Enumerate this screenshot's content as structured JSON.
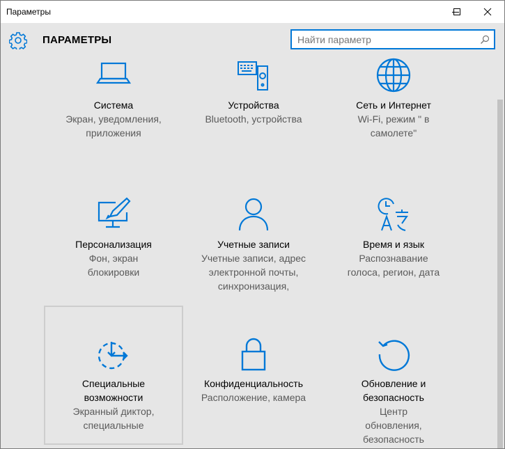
{
  "window": {
    "title": "Параметры",
    "app_title": "ПАРАМЕТРЫ",
    "accent_color": "#0078d7"
  },
  "search": {
    "placeholder": "Найти параметр",
    "icon": "search-icon"
  },
  "tiles": [
    {
      "icon": "laptop-icon",
      "title": "Система",
      "subtitle": "Экран, уведомления, приложения"
    },
    {
      "icon": "keyboard-speaker-icon",
      "title": "Устройства",
      "subtitle": "Bluetooth, устройства"
    },
    {
      "icon": "globe-icon",
      "title": "Сеть и Интернет",
      "subtitle": "Wi-Fi, режим \" в самолете\""
    },
    {
      "icon": "personalization-icon",
      "title": "Персонализация",
      "subtitle": "Фон, экран блокировки"
    },
    {
      "icon": "person-icon",
      "title": "Учетные записи",
      "subtitle": "Учетные записи, адрес электронной почты, синхронизация,"
    },
    {
      "icon": "time-language-icon",
      "title": "Время и язык",
      "subtitle": "Распознавание голоса, регион, дата"
    },
    {
      "icon": "ease-of-access-icon",
      "title": "Специальные возможности",
      "subtitle": "Экранный диктор, специальные"
    },
    {
      "icon": "lock-icon",
      "title": "Конфиденциальность",
      "subtitle": "Расположение, камера"
    },
    {
      "icon": "update-icon",
      "title": "Обновление и безопасность",
      "subtitle": "Центр обновления, безопасность"
    }
  ]
}
